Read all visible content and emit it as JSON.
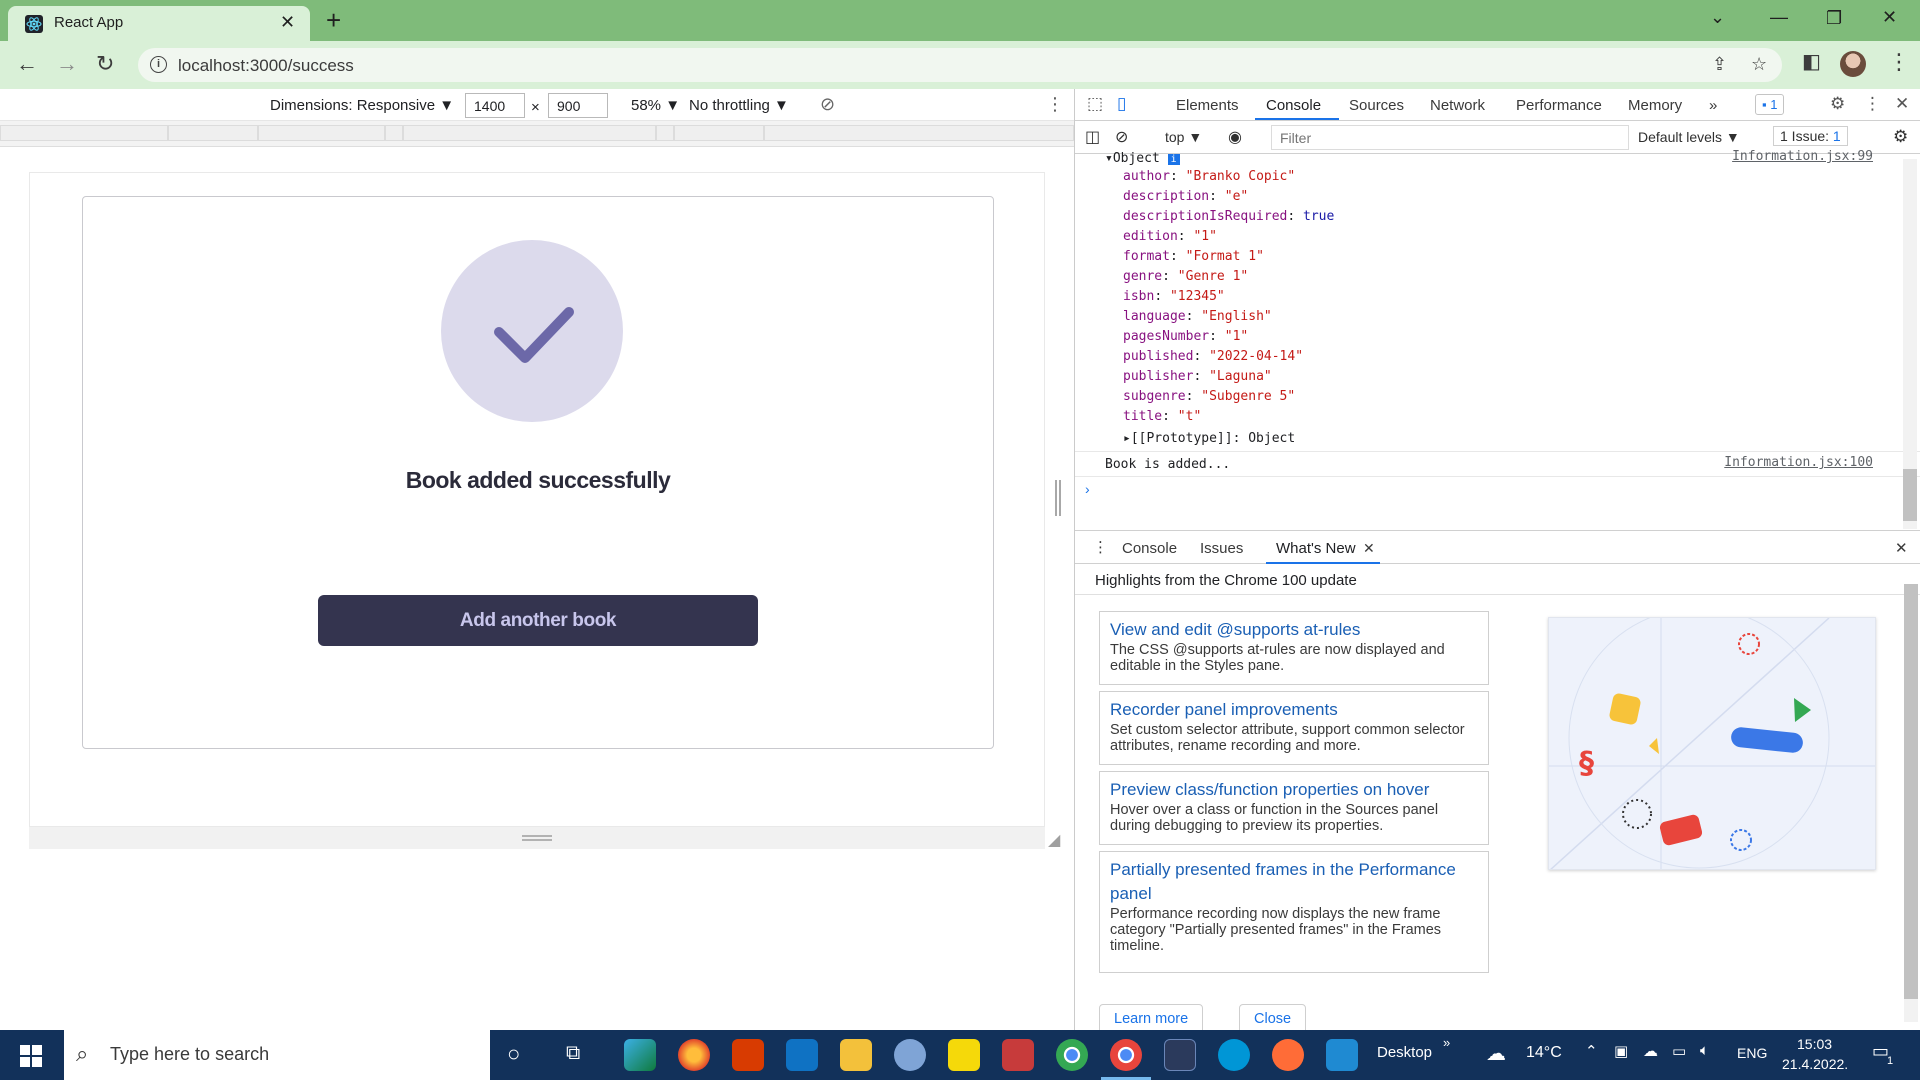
{
  "browser": {
    "tab_title": "React App",
    "url": "localhost:3000/success"
  },
  "device_toolbar": {
    "dimensions_label": "Dimensions: Responsive ▼",
    "width": "1400",
    "times": "×",
    "height": "900",
    "zoom": "58% ▼",
    "throttling": "No throttling ▼"
  },
  "app": {
    "success_title": "Book added successfully",
    "add_button": "Add another book"
  },
  "devtools": {
    "tabs": [
      "Elements",
      "Console",
      "Sources",
      "Network",
      "Performance",
      "Memory"
    ],
    "active_tab": "Console",
    "more_tabs": "»",
    "messages_badge": "1",
    "context": "top ▼",
    "filter_placeholder": "Filter",
    "levels": "Default levels ▼",
    "issues": "1 Issue:",
    "issues_count": "1",
    "object_header": "Object",
    "object_source": "Information.jsx:99",
    "fields": [
      {
        "key": "author",
        "value": "\"Branko Copic\"",
        "kind": "string"
      },
      {
        "key": "description",
        "value": "\"e\"",
        "kind": "string"
      },
      {
        "key": "descriptionIsRequired",
        "value": "true",
        "kind": "bool"
      },
      {
        "key": "edition",
        "value": "\"1\"",
        "kind": "string"
      },
      {
        "key": "format",
        "value": "\"Format 1\"",
        "kind": "string"
      },
      {
        "key": "genre",
        "value": "\"Genre 1\"",
        "kind": "string"
      },
      {
        "key": "isbn",
        "value": "\"12345\"",
        "kind": "string"
      },
      {
        "key": "language",
        "value": "\"English\"",
        "kind": "string"
      },
      {
        "key": "pagesNumber",
        "value": "\"1\"",
        "kind": "string"
      },
      {
        "key": "published",
        "value": "\"2022-04-14\"",
        "kind": "string"
      },
      {
        "key": "publisher",
        "value": "\"Laguna\"",
        "kind": "string"
      },
      {
        "key": "subgenre",
        "value": "\"Subgenre 5\"",
        "kind": "string"
      },
      {
        "key": "title",
        "value": "\"t\"",
        "kind": "string"
      }
    ],
    "prototype": "[[Prototype]]: Object",
    "log_message": "Book is added...",
    "log_source": "Information.jsx:100",
    "drawer_tabs": [
      "Console",
      "Issues",
      "What's New"
    ],
    "drawer_heading": "Highlights from the Chrome 100 update",
    "whats_new": [
      {
        "title": "View and edit @supports at-rules",
        "desc": "The CSS @supports at-rules are now displayed and editable in the Styles pane."
      },
      {
        "title": "Recorder panel improvements",
        "desc": "Set custom selector attribute, support common selector attributes, rename recording and more."
      },
      {
        "title": "Preview class/function properties on hover",
        "desc": "Hover over a class or function in the Sources panel during debugging to preview its properties."
      },
      {
        "title": "Partially presented frames in the Performance panel",
        "desc": "Performance recording now displays the new frame category \"Partially presented frames\" in the Frames timeline."
      }
    ],
    "learn_more": "Learn more",
    "close": "Close"
  },
  "taskbar": {
    "search_placeholder": "Type here to search",
    "desktop_label": "Desktop",
    "chevron": "»",
    "weather": "14°C",
    "language": "ENG",
    "time": "15:03",
    "date": "21.4.2022.",
    "notifications": "1"
  },
  "colors": {
    "chrome_frame": "#7fbb7a",
    "toolbar": "#d9f0d7",
    "button_bg": "#34344f",
    "check_circle": "#dcdaec",
    "check_mark": "#6c68a8",
    "devtools_accent": "#1a73e8",
    "taskbar": "#12315a"
  }
}
